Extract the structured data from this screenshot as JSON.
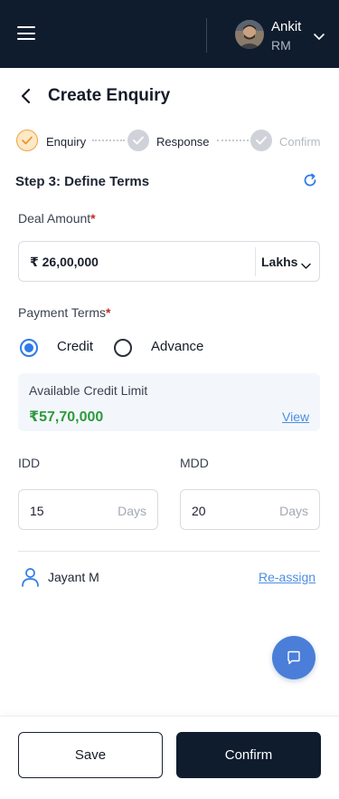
{
  "header": {
    "user_name": "Ankit",
    "user_role": "RM"
  },
  "page": {
    "title": "Create Enquiry"
  },
  "stepper": {
    "steps": [
      {
        "label": "Enquiry",
        "state": "current"
      },
      {
        "label": "Response",
        "state": "done"
      },
      {
        "label": "Confirm",
        "state": "pending"
      }
    ]
  },
  "section": {
    "title": "Step 3: Define Terms"
  },
  "deal_amount": {
    "label": "Deal Amount",
    "required_mark": "*",
    "value": "₹ 26,00,000",
    "unit": "Lakhs"
  },
  "payment_terms": {
    "label": "Payment Terms",
    "required_mark": "*",
    "options": [
      {
        "label": "Credit",
        "selected": true
      },
      {
        "label": "Advance",
        "selected": false
      }
    ]
  },
  "credit_limit": {
    "title": "Available Credit Limit",
    "amount": "₹57,70,000",
    "link": "View"
  },
  "idd": {
    "label": "IDD",
    "value": "15",
    "unit": "Days"
  },
  "mdd": {
    "label": "MDD",
    "value": "20",
    "unit": "Days"
  },
  "assignee": {
    "name": "Jayant M",
    "action": "Re-assign"
  },
  "footer": {
    "save_label": "Save",
    "confirm_label": "Confirm"
  },
  "colors": {
    "brand_dark": "#0f1c2e",
    "accent_blue": "#2f7be9",
    "success_green": "#2e9a3e",
    "step_current": "#f2a33a"
  },
  "icons": {
    "menu": "hamburger-icon",
    "back": "arrow-left-icon",
    "refresh": "refresh-icon",
    "chat": "chat-bubble-icon",
    "person": "person-icon"
  }
}
